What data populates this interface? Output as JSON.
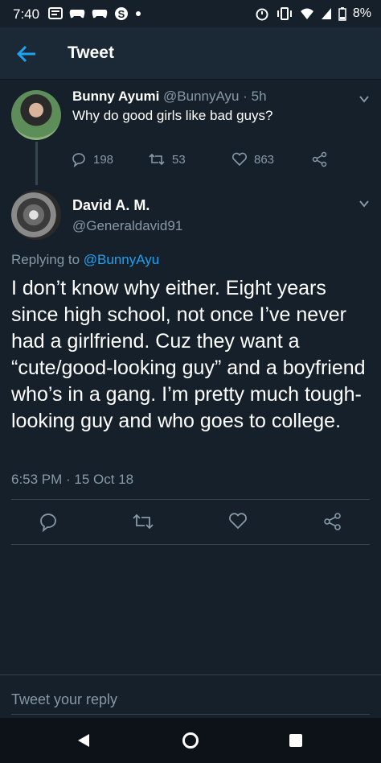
{
  "status_bar": {
    "time": "7:40",
    "battery": "8%",
    "left_icons": [
      "message-icon",
      "game-controller-icon",
      "game-controller-icon",
      "skype-icon",
      "dot-icon"
    ],
    "right_icons": [
      "alarm-icon",
      "vibrate-icon",
      "wifi-icon",
      "signal-icon",
      "battery-icon"
    ]
  },
  "header": {
    "title": "Tweet"
  },
  "tweet1": {
    "name": "Bunny Ayumi",
    "handle": "@BunnyAyu",
    "separator": "·",
    "time": "5h",
    "text": "Why do good girls like bad guys?",
    "replies": "198",
    "retweets": "53",
    "likes": "863"
  },
  "tweet2": {
    "name": "David A. M.",
    "handle": "@Generaldavid91",
    "replying_prefix": "Replying to",
    "replying_handle": "@BunnyAyu",
    "text": "I don’t know why either. Eight years since high school, not once I’ve never had a girlfriend. Cuz they want a “cute/good-looking guy” and a boyfriend who’s in a gang. I’m pretty much tough-looking guy and who goes to college.",
    "timestamp": "6:53 PM · 15 Oct 18"
  },
  "reply": {
    "placeholder": "Tweet your reply"
  },
  "colors": {
    "background": "#15202b",
    "accent": "#1da1f2",
    "muted": "#8899a6",
    "divider": "#38444d"
  }
}
